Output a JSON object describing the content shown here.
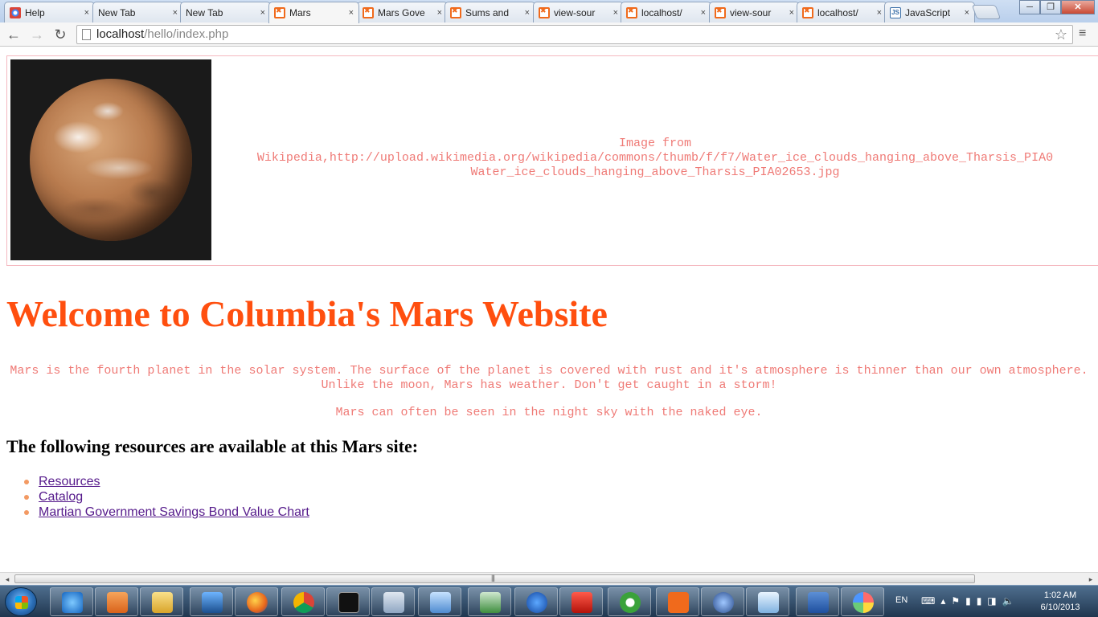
{
  "browser": {
    "tabs": [
      {
        "label": "Help",
        "icon": "chrome-help-icon"
      },
      {
        "label": "New Tab",
        "icon": "none"
      },
      {
        "label": "New Tab",
        "icon": "none"
      },
      {
        "label": "Mars",
        "icon": "xampp-icon",
        "active": true
      },
      {
        "label": "Mars Gove",
        "icon": "xampp-icon"
      },
      {
        "label": "Sums and",
        "icon": "xampp-icon"
      },
      {
        "label": "view-sour",
        "icon": "xampp-icon"
      },
      {
        "label": "localhost/",
        "icon": "xampp-icon"
      },
      {
        "label": "view-sour",
        "icon": "xampp-icon"
      },
      {
        "label": "localhost/",
        "icon": "xampp-icon"
      },
      {
        "label": "JavaScript",
        "icon": "js-icon"
      }
    ],
    "close_glyph": "×",
    "window": {
      "minimize": "─",
      "maximize": "❐",
      "close": "✕"
    },
    "nav": {
      "back": "←",
      "forward": "→",
      "reload": "↻"
    },
    "address": {
      "host": "localhost",
      "path": "/hello/index.php"
    },
    "star_glyph": "☆",
    "menu_glyph": "≡"
  },
  "page": {
    "image_alt": "Mars",
    "image_caption_lines": [
      "Image from",
      "Wikipedia,http://upload.wikimedia.org/wikipedia/commons/thumb/f/f7/Water_ice_clouds_hanging_above_Tharsis_PIA0",
      "Water_ice_clouds_hanging_above_Tharsis_PIA02653.jpg"
    ],
    "title": "Welcome to Columbia's Mars Website",
    "paragraph1": "Mars is the fourth planet in the solar system. The surface of the planet is covered with rust and it's atmosphere is thinner than our own atmosphere. Unlike the moon, Mars has weather. Don't get caught in a storm!",
    "paragraph2": "Mars can often be seen in the night sky with the naked eye.",
    "resources_heading": "The following resources are available at this Mars site:",
    "links": [
      "Resources",
      "Catalog",
      "Martian Government Savings Bond Value Chart"
    ],
    "colors": {
      "title": "#ff4f0f",
      "body_text": "#ef7a76",
      "link": "#551a8b",
      "bullet": "#f39a63"
    }
  },
  "scrollbar": {
    "left_arrow": "◂",
    "right_arrow": "▸",
    "grip": "|||"
  },
  "taskbar": {
    "apps": [
      "internet-explorer-icon",
      "media-player-icon",
      "file-explorer-icon",
      "4g-wimax-icon",
      "firefox-icon",
      "chrome-icon",
      "command-prompt-icon",
      "calculator-icon",
      "network-icon",
      "remote-desktop-icon",
      "help-icon",
      "acrobat-icon",
      "sync-icon",
      "xampp-icon",
      "security-icon",
      "notepad-icon",
      "word-icon",
      "paint-icon"
    ],
    "language": "EN",
    "clock_time": "1:02 AM",
    "clock_date": "6/10/2013"
  }
}
